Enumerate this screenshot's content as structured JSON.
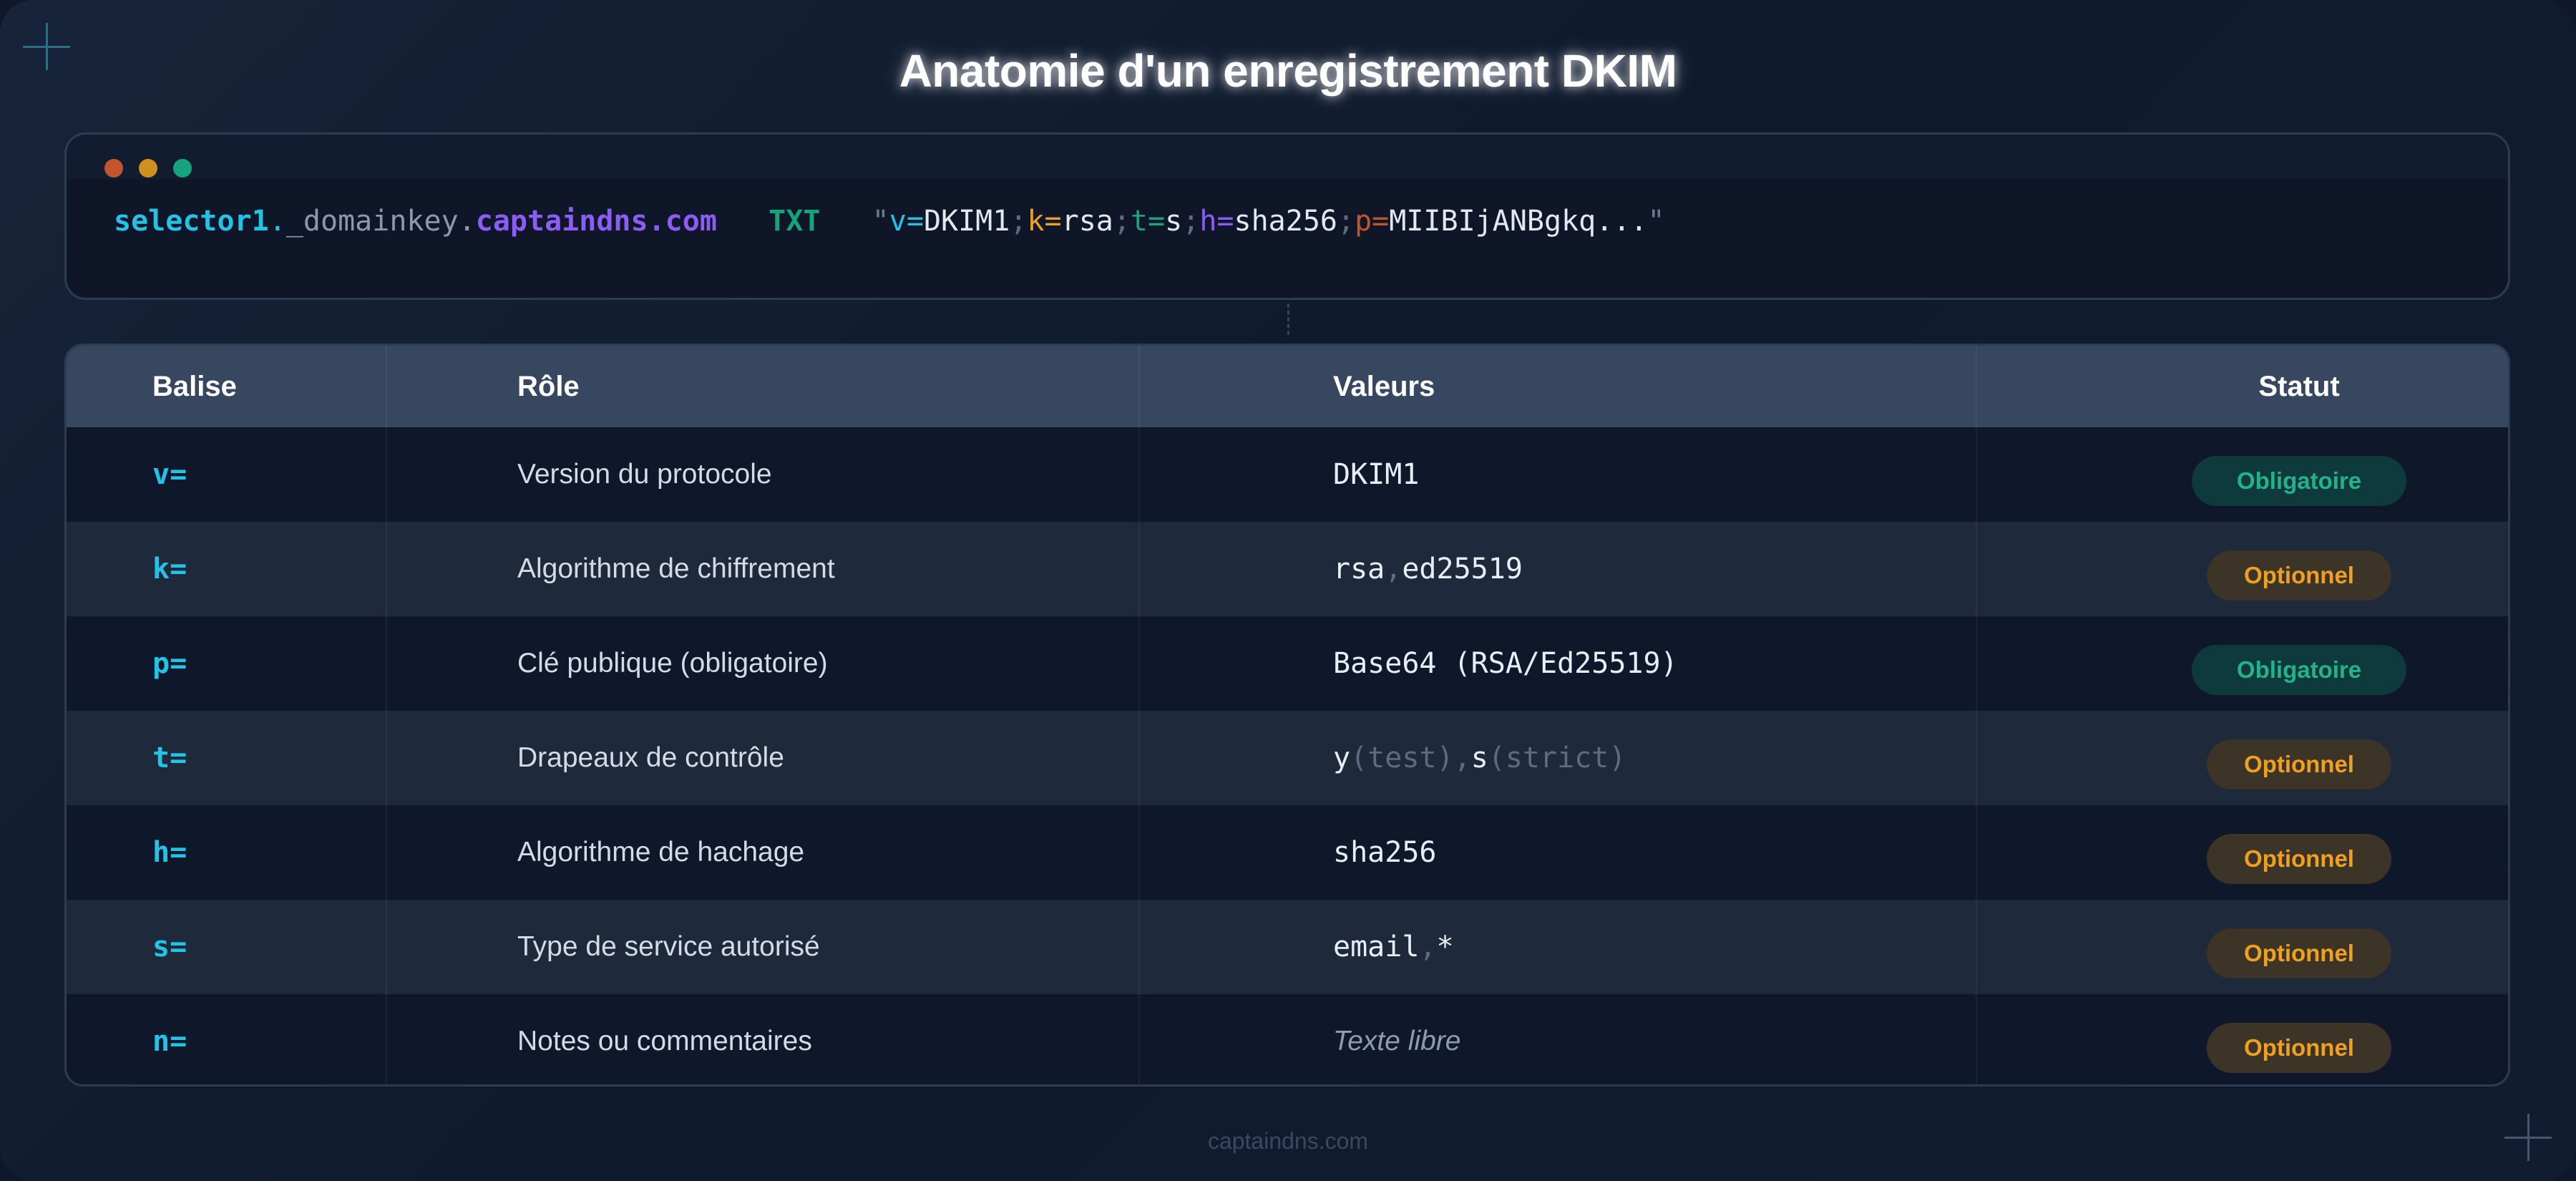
{
  "title": "Anatomie d'un enregistrement DKIM",
  "record": {
    "selector": "selector1",
    "dot1": ".",
    "domainkey": "_domainkey",
    "dot2": ".",
    "domain": "captaindns.com",
    "type": "TXT",
    "quote_open": "\"",
    "v_key": "v=",
    "v_val": "DKIM1",
    "sep1": ";",
    "k_key": "k=",
    "k_val": "rsa",
    "sep2": ";",
    "t_key": "t=",
    "t_val": "s",
    "sep3": ";",
    "h_key": "h=",
    "h_val": "sha256",
    "sep4": ";",
    "p_key": "p=",
    "p_val": "MIIBIjANBgkq...",
    "quote_close": "\""
  },
  "table": {
    "headers": [
      "Balise",
      "Rôle",
      "Valeurs",
      "Statut"
    ],
    "rows": [
      {
        "tag": "v=",
        "role": "Version du protocole",
        "value": "DKIM1",
        "status": "Obligatoire"
      },
      {
        "tag": "k=",
        "role": "Algorithme de chiffrement",
        "value_parts": [
          "rsa",
          ",",
          "ed25519"
        ],
        "status": "Optionnel"
      },
      {
        "tag": "p=",
        "role": "Clé publique (obligatoire)",
        "value": "Base64 (RSA/Ed25519)",
        "status": "Obligatoire"
      },
      {
        "tag": "t=",
        "role": "Drapeaux de contrôle",
        "value_parts": [
          "y",
          "(test)",
          ",",
          "s",
          "(strict)"
        ],
        "status": "Optionnel"
      },
      {
        "tag": "h=",
        "role": "Algorithme de hachage",
        "value": "sha256",
        "status": "Optionnel"
      },
      {
        "tag": "s=",
        "role": "Type de service autorisé",
        "value_parts": [
          "email",
          ",",
          "*"
        ],
        "status": "Optionnel"
      },
      {
        "tag": "n=",
        "role": "Notes ou commentaires",
        "value": "Texte libre",
        "status": "Optionnel"
      }
    ]
  },
  "footer": "captaindns.com",
  "colors": {
    "dot_red": "#c2542e",
    "dot_yellow": "#d1901e",
    "dot_green": "#16a37d",
    "selector": "#22c3e6",
    "domain": "#8b5cf6",
    "txt": "#14a37c",
    "tag": "#22c3e6",
    "required": "#22b38a",
    "optional": "#f0a020"
  }
}
